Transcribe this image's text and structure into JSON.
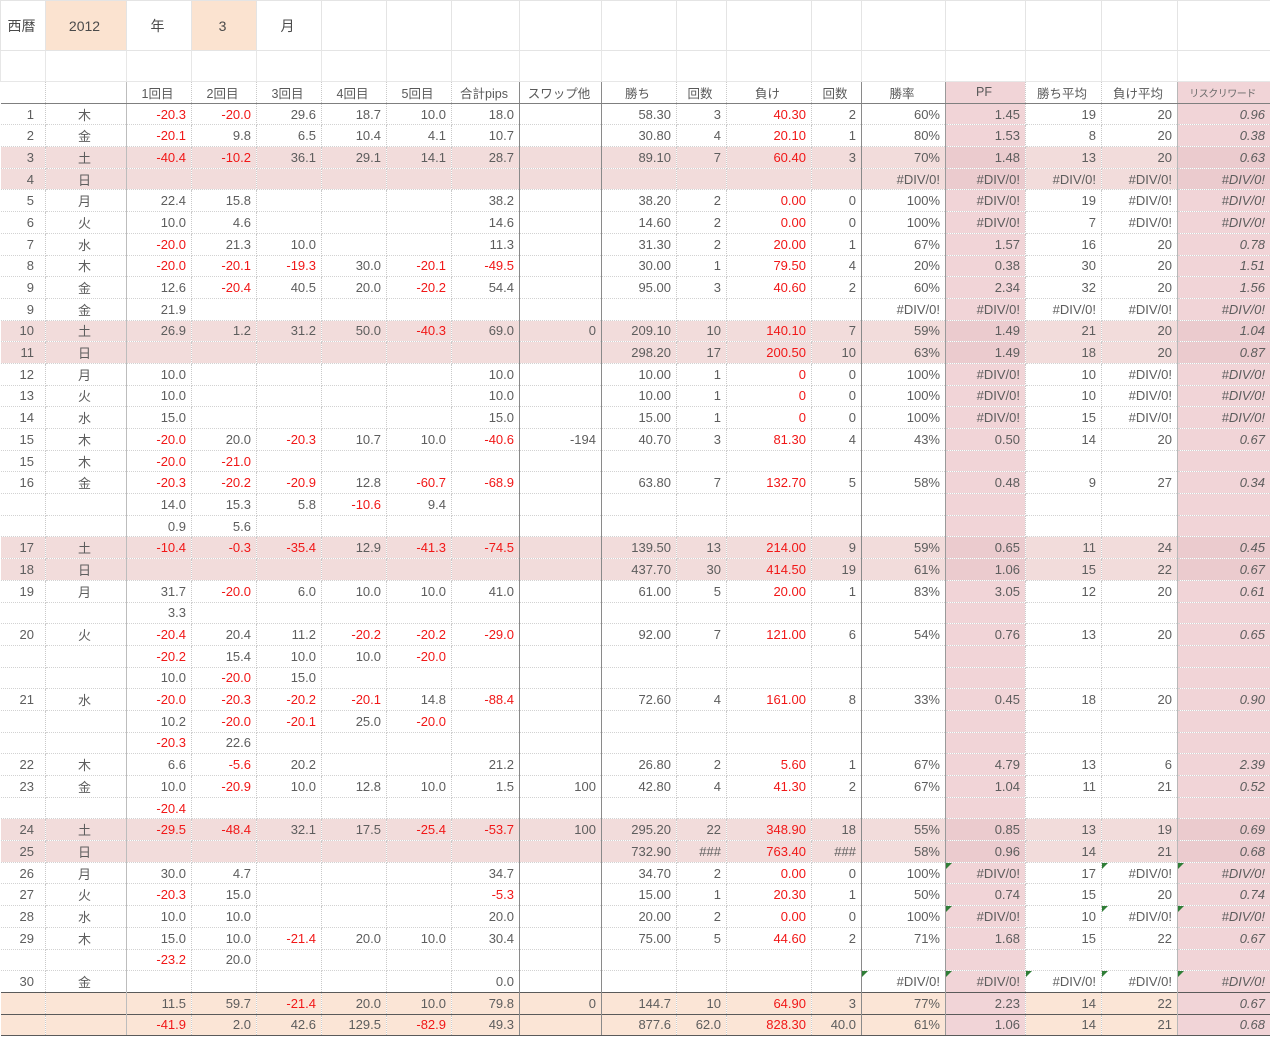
{
  "title": {
    "era_label": "西暦",
    "year": "2012",
    "year_suffix": "年",
    "month": "3",
    "month_suffix": "月"
  },
  "colors": {
    "weekend_row_bg": "#F2DCDB",
    "pink_column_bg": "#F1D4D7",
    "weekend_pink_overlap_bg": "#EBCBCE",
    "summary_row_bg": "#FBE5D6",
    "title_value_bg": "#FBE3D0",
    "negative_text": "#F11717",
    "default_text": "#5D5D5D",
    "error_triangle": "#2F7D36"
  },
  "table": {
    "headers": [
      "",
      "",
      "1回目",
      "2回目",
      "3回目",
      "4回目",
      "5回目",
      "合計pips",
      "スワップ他",
      "勝ち",
      "回数",
      "負け",
      "回数",
      "勝率",
      "PF",
      "勝ち平均",
      "負け平均",
      "リスクリワード"
    ],
    "rows": [
      {
        "day": "1",
        "wd": "木",
        "type": "normal",
        "cells": [
          "-20.3",
          "-20.0",
          "29.6",
          "18.7",
          "10.0",
          "18.0",
          "",
          "58.30",
          "3",
          "40.30",
          "2",
          "60%",
          "1.45",
          "19",
          "20",
          "0.96"
        ]
      },
      {
        "day": "2",
        "wd": "金",
        "type": "normal",
        "cells": [
          "-20.1",
          "9.8",
          "6.5",
          "10.4",
          "4.1",
          "10.7",
          "",
          "30.80",
          "4",
          "20.10",
          "1",
          "80%",
          "1.53",
          "8",
          "20",
          "0.38"
        ]
      },
      {
        "day": "3",
        "wd": "土",
        "type": "weekend",
        "cells": [
          "-40.4",
          "-10.2",
          "36.1",
          "29.1",
          "14.1",
          "28.7",
          "",
          "89.10",
          "7",
          "60.40",
          "3",
          "70%",
          "1.48",
          "13",
          "20",
          "0.63"
        ]
      },
      {
        "day": "4",
        "wd": "日",
        "type": "weekend",
        "cells": [
          "",
          "",
          "",
          "",
          "",
          "",
          "",
          "",
          "",
          "",
          "",
          "#DIV/0!",
          "#DIV/0!",
          "#DIV/0!",
          "#DIV/0!",
          "#DIV/0!"
        ]
      },
      {
        "day": "5",
        "wd": "月",
        "type": "normal",
        "cells": [
          "22.4",
          "15.8",
          "",
          "",
          "",
          "38.2",
          "",
          "38.20",
          "2",
          "0.00",
          "0",
          "100%",
          "#DIV/0!",
          "19",
          "#DIV/0!",
          "#DIV/0!"
        ]
      },
      {
        "day": "6",
        "wd": "火",
        "type": "normal",
        "cells": [
          "10.0",
          "4.6",
          "",
          "",
          "",
          "14.6",
          "",
          "14.60",
          "2",
          "0.00",
          "0",
          "100%",
          "#DIV/0!",
          "7",
          "#DIV/0!",
          "#DIV/0!"
        ]
      },
      {
        "day": "7",
        "wd": "水",
        "type": "normal",
        "cells": [
          "-20.0",
          "21.3",
          "10.0",
          "",
          "",
          "11.3",
          "",
          "31.30",
          "2",
          "20.00",
          "1",
          "67%",
          "1.57",
          "16",
          "20",
          "0.78"
        ]
      },
      {
        "day": "8",
        "wd": "木",
        "type": "normal",
        "cells": [
          "-20.0",
          "-20.1",
          "-19.3",
          "30.0",
          "-20.1",
          "-49.5",
          "",
          "30.00",
          "1",
          "79.50",
          "4",
          "20%",
          "0.38",
          "30",
          "20",
          "1.51"
        ]
      },
      {
        "day": "9",
        "wd": "金",
        "type": "normal",
        "cells": [
          "12.6",
          "-20.4",
          "40.5",
          "20.0",
          "-20.2",
          "54.4",
          "",
          "95.00",
          "3",
          "40.60",
          "2",
          "60%",
          "2.34",
          "32",
          "20",
          "1.56"
        ]
      },
      {
        "day": "9",
        "wd": "金",
        "type": "normal",
        "cells": [
          "21.9",
          "",
          "",
          "",
          "",
          "",
          "",
          "",
          "",
          "",
          "",
          "#DIV/0!",
          "#DIV/0!",
          "#DIV/0!",
          "#DIV/0!",
          "#DIV/0!"
        ]
      },
      {
        "day": "10",
        "wd": "土",
        "type": "weekend",
        "cells": [
          "26.9",
          "1.2",
          "31.2",
          "50.0",
          "-40.3",
          "69.0",
          "0",
          "209.10",
          "10",
          "140.10",
          "7",
          "59%",
          "1.49",
          "21",
          "20",
          "1.04"
        ]
      },
      {
        "day": "11",
        "wd": "日",
        "type": "weekend",
        "cells": [
          "",
          "",
          "",
          "",
          "",
          "",
          "",
          "298.20",
          "17",
          "200.50",
          "10",
          "63%",
          "1.49",
          "18",
          "20",
          "0.87"
        ]
      },
      {
        "day": "12",
        "wd": "月",
        "type": "normal",
        "cells": [
          "10.0",
          "",
          "",
          "",
          "",
          "10.0",
          "",
          "10.00",
          "1",
          "0",
          "0",
          "100%",
          "#DIV/0!",
          "10",
          "#DIV/0!",
          "#DIV/0!"
        ]
      },
      {
        "day": "13",
        "wd": "火",
        "type": "normal",
        "cells": [
          "10.0",
          "",
          "",
          "",
          "",
          "10.0",
          "",
          "10.00",
          "1",
          "0",
          "0",
          "100%",
          "#DIV/0!",
          "10",
          "#DIV/0!",
          "#DIV/0!"
        ]
      },
      {
        "day": "14",
        "wd": "水",
        "type": "normal",
        "cells": [
          "15.0",
          "",
          "",
          "",
          "",
          "15.0",
          "",
          "15.00",
          "1",
          "0",
          "0",
          "100%",
          "#DIV/0!",
          "15",
          "#DIV/0!",
          "#DIV/0!"
        ]
      },
      {
        "day": "15",
        "wd": "木",
        "type": "normal",
        "cells": [
          "-20.0",
          "20.0",
          "-20.3",
          "10.7",
          "10.0",
          "-40.6",
          "-194",
          "40.70",
          "3",
          "81.30",
          "4",
          "43%",
          "0.50",
          "14",
          "20",
          "0.67"
        ]
      },
      {
        "day": "15",
        "wd": "木",
        "type": "normal",
        "cells": [
          "-20.0",
          "-21.0",
          "",
          "",
          "",
          "",
          "",
          "",
          "",
          "",
          "",
          "",
          "",
          "",
          "",
          ""
        ]
      },
      {
        "day": "16",
        "wd": "金",
        "type": "normal",
        "cells": [
          "-20.3",
          "-20.2",
          "-20.9",
          "12.8",
          "-60.7",
          "-68.9",
          "",
          "63.80",
          "7",
          "132.70",
          "5",
          "58%",
          "0.48",
          "9",
          "27",
          "0.34"
        ]
      },
      {
        "day": "",
        "wd": "",
        "type": "normal",
        "cells": [
          "14.0",
          "15.3",
          "5.8",
          "-10.6",
          "9.4",
          "",
          "",
          "",
          "",
          "",
          "",
          "",
          "",
          "",
          "",
          ""
        ]
      },
      {
        "day": "",
        "wd": "",
        "type": "normal",
        "cells": [
          "0.9",
          "5.6",
          "",
          "",
          "",
          "",
          "",
          "",
          "",
          "",
          "",
          "",
          "",
          "",
          "",
          ""
        ]
      },
      {
        "day": "17",
        "wd": "土",
        "type": "weekend",
        "cells": [
          "-10.4",
          "-0.3",
          "-35.4",
          "12.9",
          "-41.3",
          "-74.5",
          "",
          "139.50",
          "13",
          "214.00",
          "9",
          "59%",
          "0.65",
          "11",
          "24",
          "0.45"
        ]
      },
      {
        "day": "18",
        "wd": "日",
        "type": "weekend",
        "cells": [
          "",
          "",
          "",
          "",
          "",
          "",
          "",
          "437.70",
          "30",
          "414.50",
          "19",
          "61%",
          "1.06",
          "15",
          "22",
          "0.67"
        ]
      },
      {
        "day": "19",
        "wd": "月",
        "type": "normal",
        "cells": [
          "31.7",
          "-20.0",
          "6.0",
          "10.0",
          "10.0",
          "41.0",
          "",
          "61.00",
          "5",
          "20.00",
          "1",
          "83%",
          "3.05",
          "12",
          "20",
          "0.61"
        ]
      },
      {
        "day": "",
        "wd": "",
        "type": "normal",
        "cells": [
          "3.3",
          "",
          "",
          "",
          "",
          "",
          "",
          "",
          "",
          "",
          "",
          "",
          "",
          "",
          "",
          ""
        ]
      },
      {
        "day": "20",
        "wd": "火",
        "type": "normal",
        "cells": [
          "-20.4",
          "20.4",
          "11.2",
          "-20.2",
          "-20.2",
          "-29.0",
          "",
          "92.00",
          "7",
          "121.00",
          "6",
          "54%",
          "0.76",
          "13",
          "20",
          "0.65"
        ]
      },
      {
        "day": "",
        "wd": "",
        "type": "normal",
        "cells": [
          "-20.2",
          "15.4",
          "10.0",
          "10.0",
          "-20.0",
          "",
          "",
          "",
          "",
          "",
          "",
          "",
          "",
          "",
          "",
          ""
        ]
      },
      {
        "day": "",
        "wd": "",
        "type": "normal",
        "cells": [
          "10.0",
          "-20.0",
          "15.0",
          "",
          "",
          "",
          "",
          "",
          "",
          "",
          "",
          "",
          "",
          "",
          "",
          ""
        ]
      },
      {
        "day": "21",
        "wd": "水",
        "type": "normal",
        "cells": [
          "-20.0",
          "-20.3",
          "-20.2",
          "-20.1",
          "14.8",
          "-88.4",
          "",
          "72.60",
          "4",
          "161.00",
          "8",
          "33%",
          "0.45",
          "18",
          "20",
          "0.90"
        ]
      },
      {
        "day": "",
        "wd": "",
        "type": "normal",
        "cells": [
          "10.2",
          "-20.0",
          "-20.1",
          "25.0",
          "-20.0",
          "",
          "",
          "",
          "",
          "",
          "",
          "",
          "",
          "",
          "",
          ""
        ]
      },
      {
        "day": "",
        "wd": "",
        "type": "normal",
        "cells": [
          "-20.3",
          "22.6",
          "",
          "",
          "",
          "",
          "",
          "",
          "",
          "",
          "",
          "",
          "",
          "",
          "",
          ""
        ]
      },
      {
        "day": "22",
        "wd": "木",
        "type": "normal",
        "cells": [
          "6.6",
          "-5.6",
          "20.2",
          "",
          "",
          "21.2",
          "",
          "26.80",
          "2",
          "5.60",
          "1",
          "67%",
          "4.79",
          "13",
          "6",
          "2.39"
        ]
      },
      {
        "day": "23",
        "wd": "金",
        "type": "normal",
        "cells": [
          "10.0",
          "-20.9",
          "10.0",
          "12.8",
          "10.0",
          "1.5",
          "100",
          "42.80",
          "4",
          "41.30",
          "2",
          "67%",
          "1.04",
          "11",
          "21",
          "0.52"
        ]
      },
      {
        "day": "",
        "wd": "",
        "type": "normal",
        "cells": [
          "-20.4",
          "",
          "",
          "",
          "",
          "",
          "",
          "",
          "",
          "",
          "",
          "",
          "",
          "",
          "",
          ""
        ]
      },
      {
        "day": "24",
        "wd": "土",
        "type": "weekend",
        "cells": [
          "-29.5",
          "-48.4",
          "32.1",
          "17.5",
          "-25.4",
          "-53.7",
          "100",
          "295.20",
          "22",
          "348.90",
          "18",
          "55%",
          "0.85",
          "13",
          "19",
          "0.69"
        ]
      },
      {
        "day": "25",
        "wd": "日",
        "type": "weekend",
        "cells": [
          "",
          "",
          "",
          "",
          "",
          "",
          "",
          "732.90",
          "###",
          "763.40",
          "###",
          "58%",
          "0.96",
          "14",
          "21",
          "0.68"
        ]
      },
      {
        "day": "26",
        "wd": "月",
        "type": "normal",
        "cells": [
          "30.0",
          "4.7",
          "",
          "",
          "",
          "34.7",
          "",
          "34.70",
          "2",
          "0.00",
          "0",
          "100%",
          "#DIV/0!",
          "17",
          "#DIV/0!",
          "#DIV/0!"
        ],
        "tri": [
          12,
          14,
          15
        ]
      },
      {
        "day": "27",
        "wd": "火",
        "type": "normal",
        "cells": [
          "-20.3",
          "15.0",
          "",
          "",
          "",
          "-5.3",
          "",
          "15.00",
          "1",
          "20.30",
          "1",
          "50%",
          "0.74",
          "15",
          "20",
          "0.74"
        ]
      },
      {
        "day": "28",
        "wd": "水",
        "type": "normal",
        "cells": [
          "10.0",
          "10.0",
          "",
          "",
          "",
          "20.0",
          "",
          "20.00",
          "2",
          "0.00",
          "0",
          "100%",
          "#DIV/0!",
          "10",
          "#DIV/0!",
          "#DIV/0!"
        ],
        "tri": [
          12,
          14,
          15
        ]
      },
      {
        "day": "29",
        "wd": "木",
        "type": "normal",
        "cells": [
          "15.0",
          "10.0",
          "-21.4",
          "20.0",
          "10.0",
          "30.4",
          "",
          "75.00",
          "5",
          "44.60",
          "2",
          "71%",
          "1.68",
          "15",
          "22",
          "0.67"
        ]
      },
      {
        "day": "",
        "wd": "",
        "type": "normal",
        "cells": [
          "-23.2",
          "20.0",
          "",
          "",
          "",
          "",
          "",
          "",
          "",
          "",
          "",
          "",
          "",
          "",
          "",
          ""
        ]
      },
      {
        "day": "30",
        "wd": "金",
        "type": "normal",
        "cells": [
          "",
          "",
          "",
          "",
          "",
          "0.0",
          "",
          "",
          "",
          "",
          "",
          "#DIV/0!",
          "#DIV/0!",
          "#DIV/0!",
          "#DIV/0!",
          "#DIV/0!"
        ],
        "tri": [
          11,
          12,
          13,
          14,
          15
        ]
      },
      {
        "day": "",
        "wd": "",
        "type": "sum",
        "cells": [
          "11.5",
          "59.7",
          "-21.4",
          "20.0",
          "10.0",
          "79.8",
          "0",
          "144.7",
          "10",
          "64.90",
          "3",
          "77%",
          "2.23",
          "14",
          "22",
          "0.67"
        ]
      },
      {
        "day": "",
        "wd": "",
        "type": "sum",
        "cells": [
          "-41.9",
          "2.0",
          "42.6",
          "129.5",
          "-82.9",
          "49.3",
          "",
          "877.6",
          "62.0",
          "828.30",
          "40.0",
          "61%",
          "1.06",
          "14",
          "21",
          "0.68"
        ]
      }
    ]
  }
}
